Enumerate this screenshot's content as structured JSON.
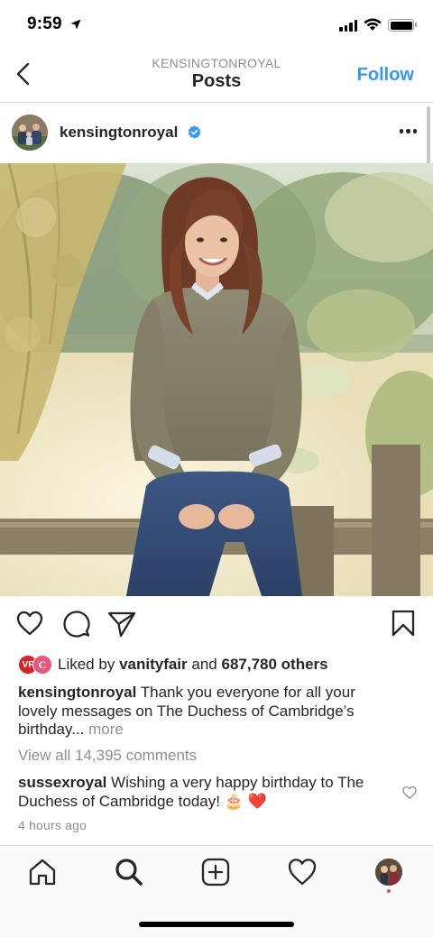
{
  "status_bar": {
    "time": "9:59"
  },
  "nav": {
    "back_icon": "chevron-left-icon",
    "subtitle": "KENSINGTONROYAL",
    "title": "Posts",
    "follow_label": "Follow"
  },
  "post": {
    "username": "kensingtonroyal",
    "verified": true,
    "photo_alt": "Portrait photo",
    "likes": {
      "prefix": "Liked by",
      "liker": "vanityfair",
      "conjunction": "and",
      "others": "687,780 others",
      "liker_badges": [
        "VF",
        "C"
      ]
    },
    "caption": {
      "username": "kensingtonroyal",
      "text": "Thank you everyone for all your lovely messages on The Duchess of Cambridge’s birthday...",
      "more": "more"
    },
    "view_comments": "View all 14,395 comments",
    "comment": {
      "username": "sussexroyal",
      "text": "Wishing a very happy birthday to The Duchess of Cambridge today! 🎂 ❤️"
    },
    "timestamp": "4 hours ago"
  },
  "colors": {
    "accent": "#3897f0",
    "verified": "#3897f0",
    "muted": "#8e8e8e",
    "heart": "#ed4956"
  },
  "tab_bar": {
    "icons": [
      "home-icon",
      "search-icon",
      "add-post-icon",
      "activity-heart-icon",
      "profile-avatar"
    ],
    "active": "search-icon"
  }
}
